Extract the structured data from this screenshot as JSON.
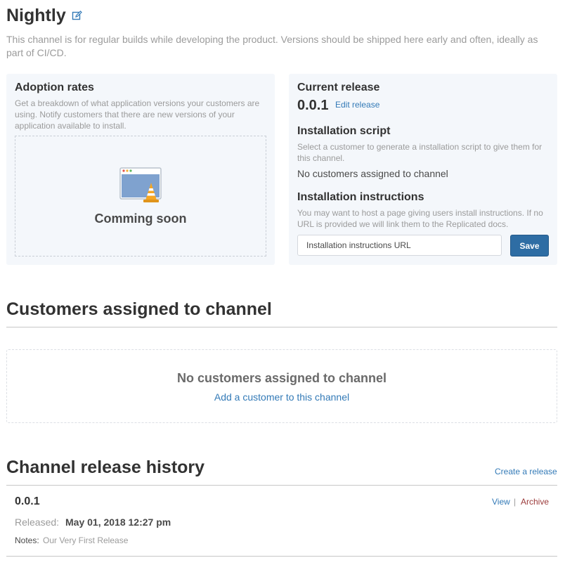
{
  "channel": {
    "title": "Nightly",
    "description": "This channel is for regular builds while developing the product. Versions should be shipped here early and often, ideally as part of CI/CD.",
    "edit_icon": "pencil-edit-icon"
  },
  "adoption": {
    "heading": "Adoption rates",
    "help": "Get a breakdown of what application versions your customers are using. Notify customers that there are new versions of your application available to install.",
    "coming_soon": "Comming soon",
    "illustration_icon": "browser-window-traffic-cone-icon"
  },
  "current_release": {
    "heading": "Current release",
    "version": "0.0.1",
    "edit_link": "Edit release"
  },
  "install_script": {
    "heading": "Installation script",
    "help": "Select a customer to generate a installation script to give them for this channel.",
    "status": "No customers assigned to channel"
  },
  "install_instructions": {
    "heading": "Installation instructions",
    "help": "You may want to host a page giving users install instructions. If no URL is provided we will link them to the Replicated docs.",
    "placeholder": "Installation instructions URL",
    "value": "",
    "save_label": "Save"
  },
  "customers": {
    "title": "Customers assigned to channel",
    "empty_title": "No customers assigned to channel",
    "add_link": "Add a customer to this channel"
  },
  "history": {
    "title": "Channel release history",
    "create_link": "Create a release",
    "releases": [
      {
        "version": "0.0.1",
        "released_label": "Released:",
        "released_date": "May 01, 2018 12:27 pm",
        "notes_label": "Notes:",
        "notes": "Our Very First Release",
        "view_label": "View",
        "separator": "|",
        "archive_label": "Archive"
      }
    ]
  },
  "colors": {
    "link": "#337ab7",
    "primary_button": "#2e6da4",
    "archive": "#9b3a3a",
    "card_background": "#f4f7fb",
    "muted_text": "#9b9b9b"
  }
}
